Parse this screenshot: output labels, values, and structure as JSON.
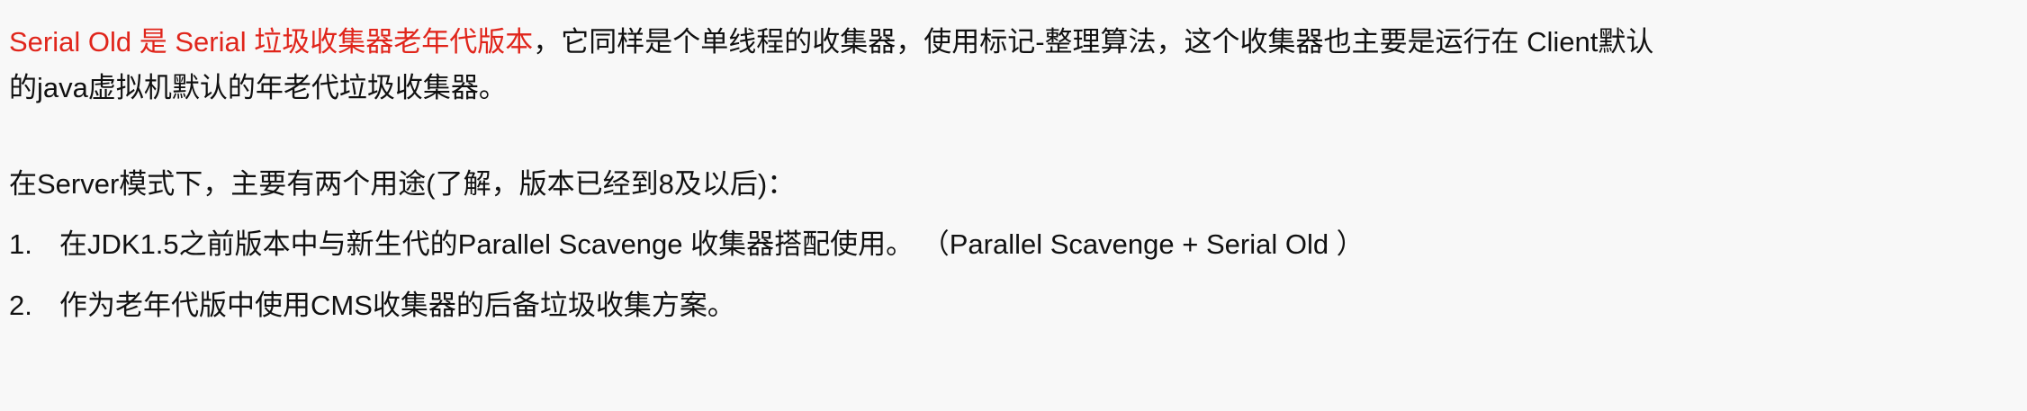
{
  "paragraph1": {
    "red_1": "Serial Old 是 Serial 垃圾收集器老年代版本",
    "black_1": "，它同样是个单线程的收集器，使用标记-整理算法，这个收集器也主要是运行在 Client默认",
    "line_2": "的java虚拟机默认的年老代垃圾收集器。"
  },
  "paragraph2": {
    "text": "在Server模式下，主要有两个用途(了解，版本已经到8及以后)："
  },
  "list": [
    {
      "number": "1.",
      "text": "在JDK1.5之前版本中与新生代的Parallel Scavenge 收集器搭配使用。 （Parallel Scavenge + Serial Old ）"
    },
    {
      "number": "2.",
      "text": "作为老年代版中使用CMS收集器的后备垃圾收集方案。"
    }
  ]
}
